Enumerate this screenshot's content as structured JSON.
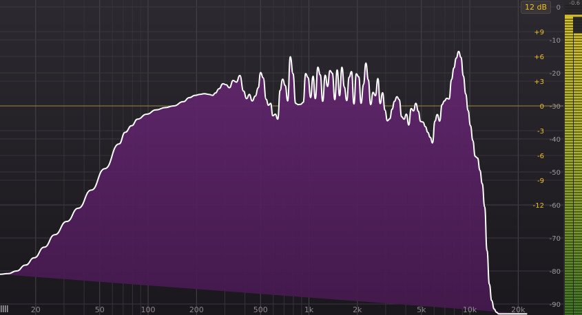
{
  "app": {
    "range_button_label": "12 dB",
    "peak_readout": "-0.6"
  },
  "colors": {
    "fill": "#54215f",
    "curve": "#ffffff",
    "zero_line": "#b2a33a",
    "db_scale": "#f0c024",
    "level_scale": "#9a959a",
    "meter_green": "#5f8c2a",
    "meter_yellow": "#d6c02f"
  },
  "chart_data": {
    "type": "area",
    "x_scale": "log",
    "x_ticks": [
      {
        "value": 20,
        "label": "20"
      },
      {
        "value": 50,
        "label": "50"
      },
      {
        "value": 100,
        "label": "100"
      },
      {
        "value": 200,
        "label": "200"
      },
      {
        "value": 500,
        "label": "500"
      },
      {
        "value": 1000,
        "label": "1k"
      },
      {
        "value": 2000,
        "label": "2k"
      },
      {
        "value": 5000,
        "label": "5k"
      },
      {
        "value": 10000,
        "label": "10k"
      },
      {
        "value": 20000,
        "label": "20k"
      }
    ],
    "xlim": [
      12,
      25500
    ],
    "db_ticks": [
      "+9",
      "+6",
      "+3",
      "0",
      "-3",
      "-6",
      "-9",
      "-12"
    ],
    "db_values": [
      9,
      6,
      3,
      0,
      -3,
      -6,
      -9,
      -12
    ],
    "level_ticks": [
      "0",
      "-10",
      "-20",
      "-30",
      "-40",
      "-50",
      "-60",
      "-70",
      "-80",
      "-90"
    ],
    "level_values": [
      0,
      -10,
      -20,
      -30,
      -40,
      -50,
      -60,
      -70,
      -80,
      -90
    ],
    "ylim": [
      -93,
      0
    ],
    "spectrum": {
      "x": [
        12,
        13.5,
        15.2,
        17.3,
        19.6,
        22.6,
        26.3,
        31.2,
        36.8,
        44.3,
        53.8,
        66,
        72,
        79,
        86,
        98,
        112,
        128,
        144,
        166,
        180,
        196,
        210,
        224,
        238,
        252,
        262,
        276,
        292,
        306,
        320,
        338,
        354,
        372,
        392,
        410,
        426,
        444,
        464,
        484,
        500,
        520,
        542,
        560,
        578,
        596,
        618,
        640,
        662,
        686,
        712,
        738,
        766,
        796,
        826,
        858,
        890,
        922,
        954,
        988,
        1024,
        1060,
        1096,
        1136,
        1176,
        1218,
        1262,
        1306,
        1350,
        1398,
        1448,
        1498,
        1550,
        1604,
        1660,
        1718,
        1778,
        1840,
        1904,
        1970,
        2040,
        2110,
        2184,
        2260,
        2338,
        2420,
        2504,
        2592,
        2682,
        2774,
        2870,
        2970,
        3074,
        3180,
        3290,
        3404,
        3522,
        3644,
        3770,
        3900,
        4036,
        4176,
        4320,
        4470,
        4624,
        4784,
        4950,
        5120,
        5298,
        5482,
        5672,
        5868,
        6070,
        6280,
        6498,
        6722,
        6954,
        7194,
        7442,
        7700,
        7966,
        8240,
        8524,
        8818,
        9122,
        9436,
        9762,
        10098,
        10446,
        10806,
        11178,
        11562,
        11960,
        12372,
        12798,
        13238,
        13694,
        14164,
        14650,
        15154,
        15674,
        16212,
        16770,
        17346,
        17942,
        18560,
        19198,
        19858,
        20542,
        21248,
        21978,
        22734,
        23516,
        24324,
        25000
      ],
      "y": [
        -81,
        -80.8,
        -80,
        -78.2,
        -76,
        -72.8,
        -69,
        -65,
        -61,
        -55.5,
        -49,
        -41.5,
        -38,
        -36,
        -34,
        -32.5,
        -31.2,
        -30.5,
        -30,
        -28.7,
        -27.5,
        -26.8,
        -26.5,
        -26.3,
        -26.5,
        -26.8,
        -26.1,
        -24.8,
        -23.3,
        -23.6,
        -24.5,
        -22.3,
        -22.8,
        -20.8,
        -25.5,
        -27.8,
        -26.5,
        -28.5,
        -27,
        -24.5,
        -19.9,
        -21.5,
        -28,
        -29.8,
        -29.2,
        -33,
        -32.5,
        -34,
        -25.3,
        -21.9,
        -23.8,
        -28.5,
        -15.1,
        -20.2,
        -29.2,
        -29.6,
        -29.5,
        -28.9,
        -20.2,
        -21.4,
        -27.5,
        -21,
        -27.8,
        -18.3,
        -20.6,
        -28.6,
        -20.7,
        -24.1,
        -19.3,
        -20.1,
        -28.1,
        -19.1,
        -26.9,
        -18.3,
        -24.3,
        -28.4,
        -21.3,
        -19.6,
        -29.4,
        -20.3,
        -21.2,
        -29.2,
        -23.5,
        -17,
        -22.1,
        -29.6,
        -25.9,
        -26.9,
        -21.7,
        -29.3,
        -26,
        -31.3,
        -34.5,
        -33.9,
        -31,
        -28.6,
        -27.2,
        -28.1,
        -33.3,
        -34,
        -32.5,
        -35.8,
        -30.8,
        -31.5,
        -29.2,
        -31.6,
        -34.7,
        -34.9,
        -36.3,
        -38,
        -39.5,
        -41.2,
        -34.6,
        -32.6,
        -34.6,
        -29.6,
        -28.5,
        -27.7,
        -27.9,
        -22,
        -18.5,
        -15.5,
        -13.5,
        -15.3,
        -20.9,
        -26.4,
        -31.4,
        -36,
        -40.5,
        -45.3,
        -45.8,
        -49.5,
        -53.6,
        -60.6,
        -73.8,
        -84,
        -89,
        -91.5,
        -92.5,
        -93,
        -93,
        -93,
        -93,
        -93,
        -93,
        -93,
        -93,
        -93,
        -93,
        -93,
        -93,
        -93
      ]
    },
    "meter": {
      "level_left_db": -1.2,
      "level_right_db": -3.2
    }
  }
}
